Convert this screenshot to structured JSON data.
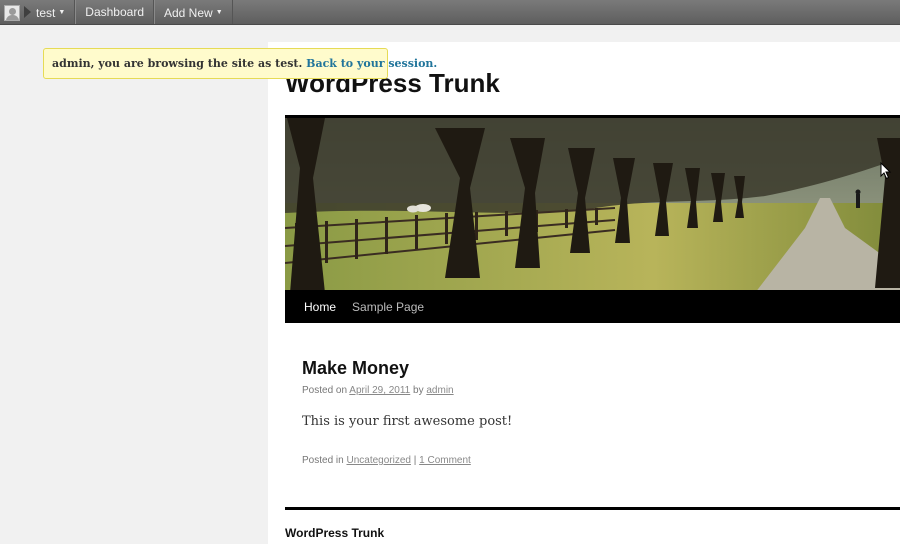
{
  "adminbar": {
    "user": "test",
    "dashboard": "Dashboard",
    "add_new": "Add New",
    "caret": "▼"
  },
  "notice": {
    "message": "admin, you are browsing the site as test.",
    "link": "Back to your session."
  },
  "site": {
    "title": "WordPress Trunk",
    "nav": [
      "Home",
      "Sample Page"
    ],
    "header_image": "tree-lined-road-photo"
  },
  "post": {
    "title": "Make Money",
    "posted_on_label": "Posted on",
    "date": "April 29, 2011",
    "by_label": "by",
    "author": "admin",
    "content": "This is your first awesome post!",
    "posted_in_label": "Posted in",
    "category": "Uncategorized",
    "separator": "|",
    "comments": "1 Comment"
  },
  "footer": {
    "site_title": "WordPress Trunk"
  },
  "colors": {
    "adminbar_bg": "#6b6b6b",
    "notice_bg": "#fffbcc",
    "link": "#21759b",
    "nav_bg": "#000000"
  }
}
